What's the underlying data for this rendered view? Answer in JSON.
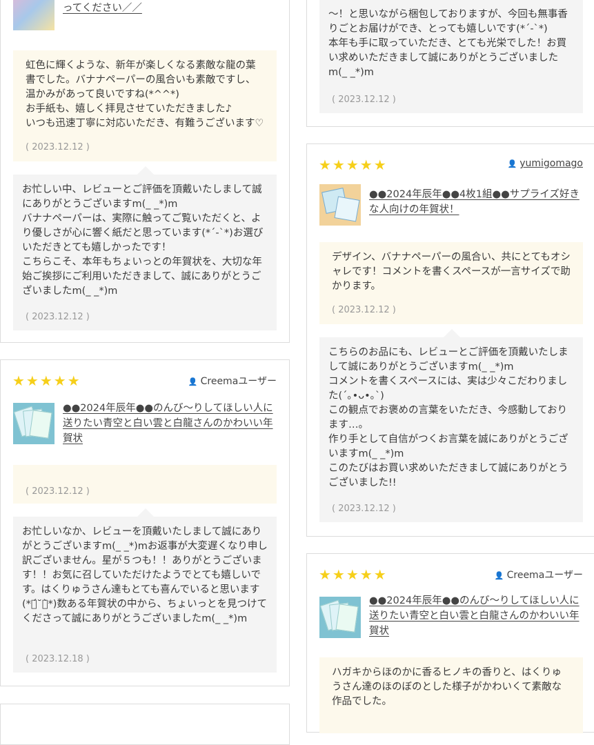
{
  "cards": [
    {
      "title_fragment": "ように キラキラ輝く一年になってほしい人に贈ってください／／",
      "review": "虹色に輝くような、新年が楽しくなる素敵な龍の葉書でした。バナナペーパーの風合いも素敵ですし、温かみがあって良いですね(*^^*)\nお手紙も、嬉しく拝見させていただきました♪\nいつも迅速丁寧に対応いただき、有難うございます♡",
      "review_date": "( 2023.12.12 )",
      "reply": "お忙しい中、レビューとご評価を頂戴いたしまして誠にありがとうございますm(_ _*)m\nバナナペーパーは、実際に触ってご覧いただくと、より優しさが心に響く紙だと思っています(*´-`*)お選びいただきとても嬉しかったです！\nこちらこそ、本年もちょいっとの年賀状を、大切な年始ご挨拶にご利用いただきまして、誠にありがとうございましたm(_ _*)m",
      "reply_date": "( 2023.12.12 )"
    },
    {
      "stars": "★★★★★",
      "user": "Creemaユーザー",
      "title": "●●2024年辰年●●のんび～りしてほしい人に送りたい青空と白い雲と白龍さんのかわいい年賀状",
      "review_date": "( 2023.12.12 )",
      "reply": "お忙しいなか、レビューを頂戴いたしまして誠にありがとうございますm(_ _*)mお返事が大変遅くなり申し訳ございません。星が５つも！！ありがとうございます！！お気に召していただけたようでとても嬉しいです。はくりゅうさん達もとても喜んでいると思います(*ฅ́˘ฅ̀*)数ある年賀状の中から、ちょいっとを見つけてくださって誠にありがとうございましたm(_ _*)m",
      "reply_date": "( 2023.12.18 )"
    },
    {
      "reply_fragment": "～！と思いながら梱包しておりますが、今回も無事香りごとお届けができ、とっても嬉しいです(*´-`*)\n本年も手に取っていただき、とても光栄でした！お買い求めいただきまして誠にありがとうございましたm(_ _*)m",
      "reply_date": "( 2023.12.12 )"
    },
    {
      "stars": "★★★★★",
      "user": "yumigomago",
      "title": "●●2024年辰年●●4枚1組●●サプライズ好きな人向けの年賀状！",
      "review": "デザイン、バナナペーパーの風合い、共にとてもオシャレです！コメントを書くスペースが一言サイズで助かります。",
      "review_date": "( 2023.12.12 )",
      "reply": "こちらのお品にも、レビューとご評価を頂戴いたしまして誠にありがとうございますm(_ _*)m\nコメントを書くスペースには、実は少々こだわりました(´｡•ᴗ•｡`)\nこの観点でお褒めの言葉をいただき、今感動しております…。\n作り手として自信がつくお言葉を誠にありがとうございますm(_ _*)m\nこのたびはお買い求めいただきまして誠にありがとうございました!!",
      "reply_date": "( 2023.12.12 )"
    },
    {
      "stars": "★★★★★",
      "user": "Creemaユーザー",
      "title": "●●2024年辰年●●のんび～りしてほしい人に送りたい青空と白い雲と白龍さんのかわいい年賀状",
      "review": "ハガキからほのかに香るヒノキの香りと、はくりゅうさん達のほのぼのとした様子がかわいくて素敵な作品でした。"
    }
  ]
}
